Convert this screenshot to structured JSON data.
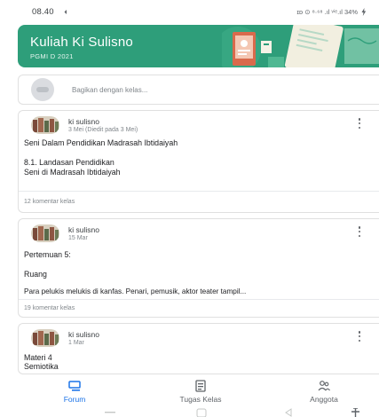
{
  "status_bar": {
    "time": "08.40",
    "icons_text": "ɪᴅ ⊙ ⁸·⁶⁸ .ıl ᵛⁱᵉ.ıl 34%",
    "battery_percent": "34%"
  },
  "banner": {
    "title": "Kuliah Ki Sulisno",
    "subtitle": "PGMI D 2021",
    "color": "#2e9e7a"
  },
  "share": {
    "placeholder": "Bagikan dengan kelas..."
  },
  "posts": [
    {
      "author": "ki sulisno",
      "date": "3 Mei (Diedit pada 3 Mei)",
      "lines": [
        "Seni Dalam Pendidikan Madrasah Ibtidaiyah",
        "",
        "8.1. Landasan Pendidikan",
        "Seni di Madrasah Ibtidaiyah"
      ],
      "comments": "12 komentar kelas"
    },
    {
      "author": "ki sulisno",
      "date": "15 Mar",
      "lines": [
        "Pertemuan 5:",
        "",
        "Ruang",
        "",
        "Para pelukis melukis di kanfas. Penari, pemusik, aktor teater tampil..."
      ],
      "comments": "19 komentar kelas"
    },
    {
      "author": "ki sulisno",
      "date": "1 Mar",
      "lines": [
        "Materi 4",
        "Semiotika"
      ],
      "comments": ""
    }
  ],
  "bottom_nav": {
    "items": [
      {
        "label": "Forum",
        "icon": "forum-icon",
        "active": true
      },
      {
        "label": "Tugas Kelas",
        "icon": "classwork-icon",
        "active": false
      },
      {
        "label": "Anggota",
        "icon": "people-icon",
        "active": false
      }
    ],
    "active_color": "#1a73e8"
  }
}
